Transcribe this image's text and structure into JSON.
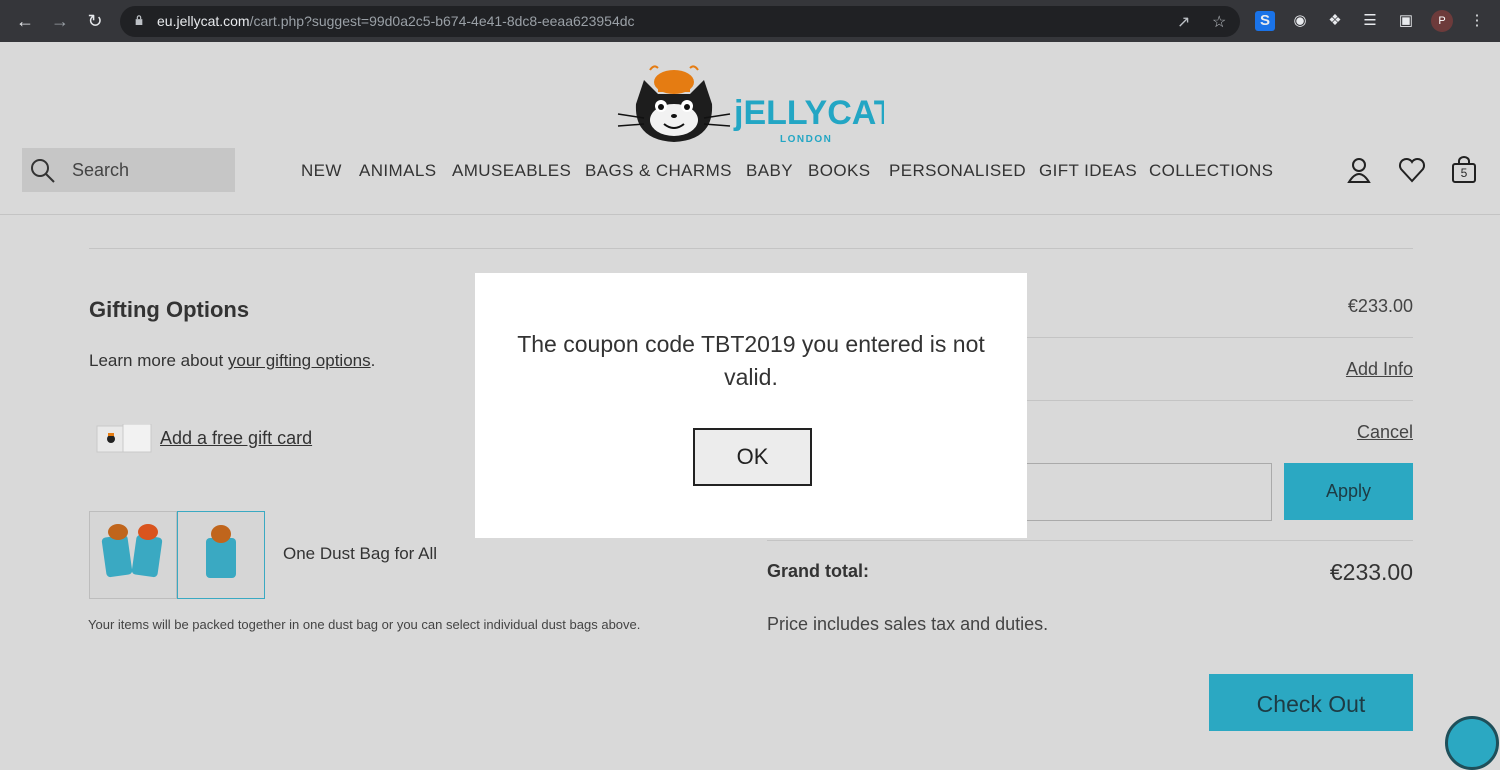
{
  "browser": {
    "url_host": "eu.jellycat.com",
    "url_path": "/cart.php?suggest=99d0a2c5-b674-4e41-8dc8-eeaa623954dc",
    "profile_initial": "P"
  },
  "header": {
    "logo_text": "jELLYCAT",
    "logo_sub": "LONDON",
    "search_placeholder": "Search",
    "menu": [
      "NEW",
      "ANIMALS",
      "AMUSEABLES",
      "BAGS & CHARMS",
      "BABY",
      "BOOKS",
      "PERSONALISED",
      "GIFT IDEAS",
      "COLLECTIONS"
    ],
    "cart_count": "5"
  },
  "gifting": {
    "title": "Gifting Options",
    "learn_prefix": "Learn more about ",
    "learn_link": "your gifting options",
    "learn_suffix": ".",
    "gift_card_link": "Add a free gift card",
    "dust_bag_label": "One Dust Bag for All",
    "dust_bag_note": "Your items will be packed together in one dust bag or you can select individual dust bags above."
  },
  "summary": {
    "subtotal": "€233.00",
    "add_info": "Add Info",
    "cancel": "Cancel",
    "apply": "Apply",
    "grand_total_label": "Grand total:",
    "grand_total": "€233.00",
    "tax_note": "Price includes sales tax and duties.",
    "checkout": "Check Out"
  },
  "modal": {
    "message": "The coupon code TBT2019 you entered is not valid.",
    "ok": "OK"
  },
  "colors": {
    "accent": "#2ba8c2",
    "page_bg": "#d9d9d9",
    "chrome_bg": "#35363a"
  }
}
